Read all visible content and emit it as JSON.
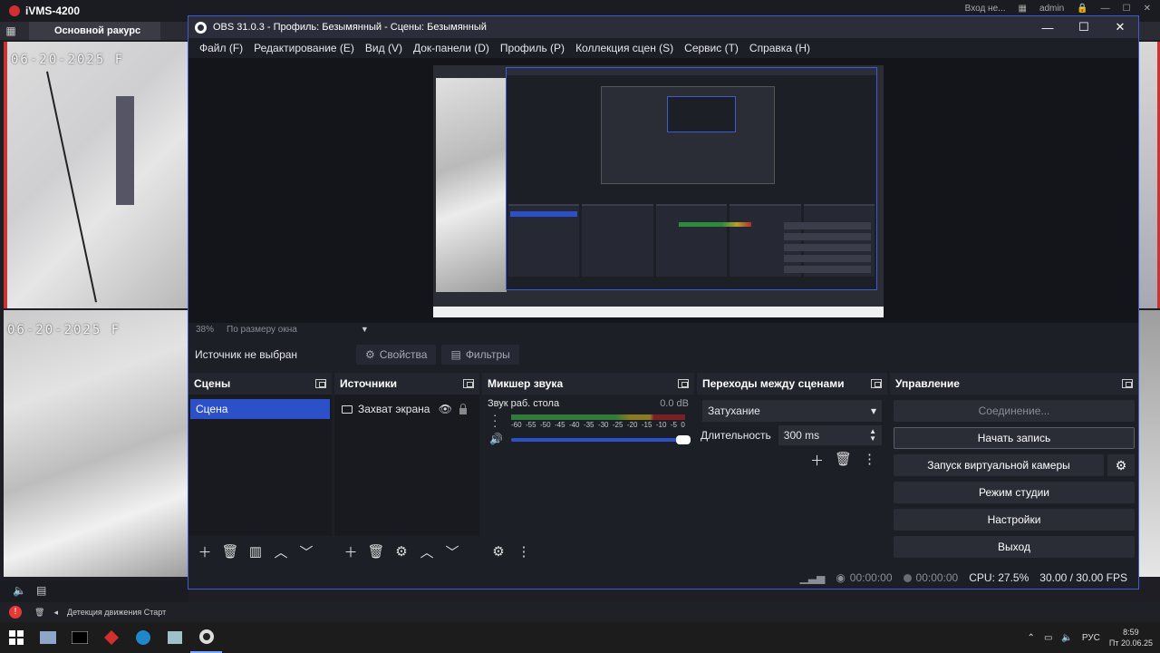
{
  "ivms": {
    "title": "iVMS-4200",
    "tab": "Основной ракурс",
    "user": "admin",
    "login_hint": "Вход не...",
    "date_stamp_1": "06-20-2025 F",
    "date_stamp_2": "06-20-2025 F",
    "status_text": "Детекция движения Старт"
  },
  "obs": {
    "window_title": "OBS 31.0.3 - Профиль: Безымянный - Сцены: Безымянный",
    "menu": [
      "Файл (F)",
      "Редактирование (E)",
      "Вид (V)",
      "Док-панели (D)",
      "Профиль (P)",
      "Коллекция сцен (S)",
      "Сервис (T)",
      "Справка (H)"
    ],
    "zoom": {
      "percent": "38%",
      "mode": "По размеру окна"
    },
    "source_bar": {
      "label": "Источник не выбран",
      "properties": "Свойства",
      "filters": "Фильтры"
    },
    "scenes": {
      "title": "Сцены",
      "items": [
        "Сцена"
      ]
    },
    "sources": {
      "title": "Источники",
      "items": [
        "Захват экрана"
      ]
    },
    "mixer": {
      "title": "Микшер звука",
      "channel": "Звук раб. стола",
      "level": "0.0 dB",
      "ticks": [
        "-60",
        "-55",
        "-50",
        "-45",
        "-40",
        "-35",
        "-30",
        "-25",
        "-20",
        "-15",
        "-10",
        "-5",
        "0"
      ],
      "volume": 1.0
    },
    "transitions": {
      "title": "Переходы между сценами",
      "type": "Затухание",
      "duration_label": "Длительность",
      "duration": "300 ms"
    },
    "controls": {
      "title": "Управление",
      "connection": "Соединение...",
      "start_recording": "Начать запись",
      "virtual_camera": "Запуск виртуальной камеры",
      "studio_mode": "Режим студии",
      "settings": "Настройки",
      "exit": "Выход"
    },
    "status": {
      "stream_time": "00:00:00",
      "record_time": "00:00:00",
      "cpu": "CPU: 27.5%",
      "fps": "30.00 / 30.00 FPS"
    }
  },
  "taskbar": {
    "lang": "РУС",
    "time": "8:59",
    "date": "Пт 20.06.25"
  },
  "colors": {
    "accent": "#2b50c8",
    "obs_bg": "#1d1f26",
    "title_bar": "#2b2e3a"
  }
}
